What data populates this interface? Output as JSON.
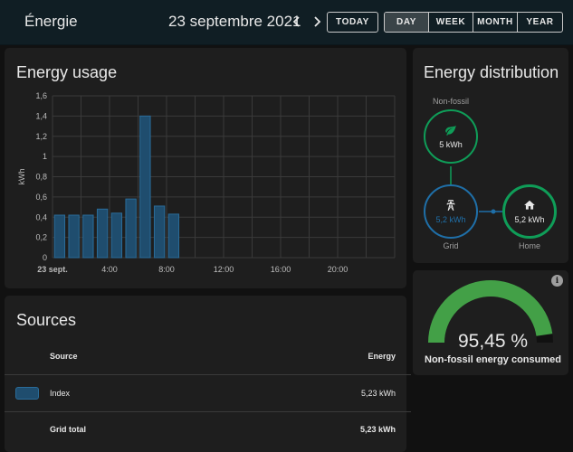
{
  "header": {
    "title": "Énergie",
    "date": "23 septembre 2021",
    "prev_icon": "chevron-left",
    "next_icon": "chevron-right",
    "today_label": "TODAY",
    "periods": [
      "DAY",
      "WEEK",
      "MONTH",
      "YEAR"
    ],
    "active_period": "DAY"
  },
  "usage": {
    "title": "Energy usage",
    "chart_data": {
      "type": "bar",
      "ylabel": "kWh",
      "ylim": [
        0,
        1.6
      ],
      "yticks": [
        "0",
        "0,2",
        "0,4",
        "0,6",
        "0,8",
        "1",
        "1,2",
        "1,4",
        "1,6"
      ],
      "xticks": [
        "23 sept.",
        "4:00",
        "8:00",
        "12:00",
        "16:00",
        "20:00"
      ],
      "hours": [
        0,
        1,
        2,
        3,
        4,
        5,
        6,
        7,
        8
      ],
      "values": [
        0.42,
        0.42,
        0.42,
        0.48,
        0.44,
        0.58,
        1.4,
        0.51,
        0.43
      ],
      "grid": true,
      "color": "#1f4d6e",
      "border_color": "#2a6c99"
    }
  },
  "sources": {
    "title": "Sources",
    "col_source": "Source",
    "col_energy": "Energy",
    "rows": [
      {
        "name": "Index",
        "energy": "5,23 kWh",
        "color": "#1f4d6e"
      }
    ],
    "total_label": "Grid total",
    "total_value": "5,23 kWh"
  },
  "distribution": {
    "title": "Energy distribution",
    "nonfossil_label": "Non-fossil",
    "nonfossil_value": "5 kWh",
    "nonfossil_icon": "leaf-icon",
    "grid_label": "Grid",
    "grid_value": "5,2 kWh",
    "grid_icon": "transmission-tower-icon",
    "home_label": "Home",
    "home_value": "5,2 kWh",
    "home_icon": "home-icon",
    "green": "#0f9d58",
    "blue": "#1f6fa8"
  },
  "gauge": {
    "value_text": "95,45 %",
    "value": 95.45,
    "label": "Non-fossil energy consumed",
    "color": "#43a047",
    "info_icon": "info-icon"
  }
}
